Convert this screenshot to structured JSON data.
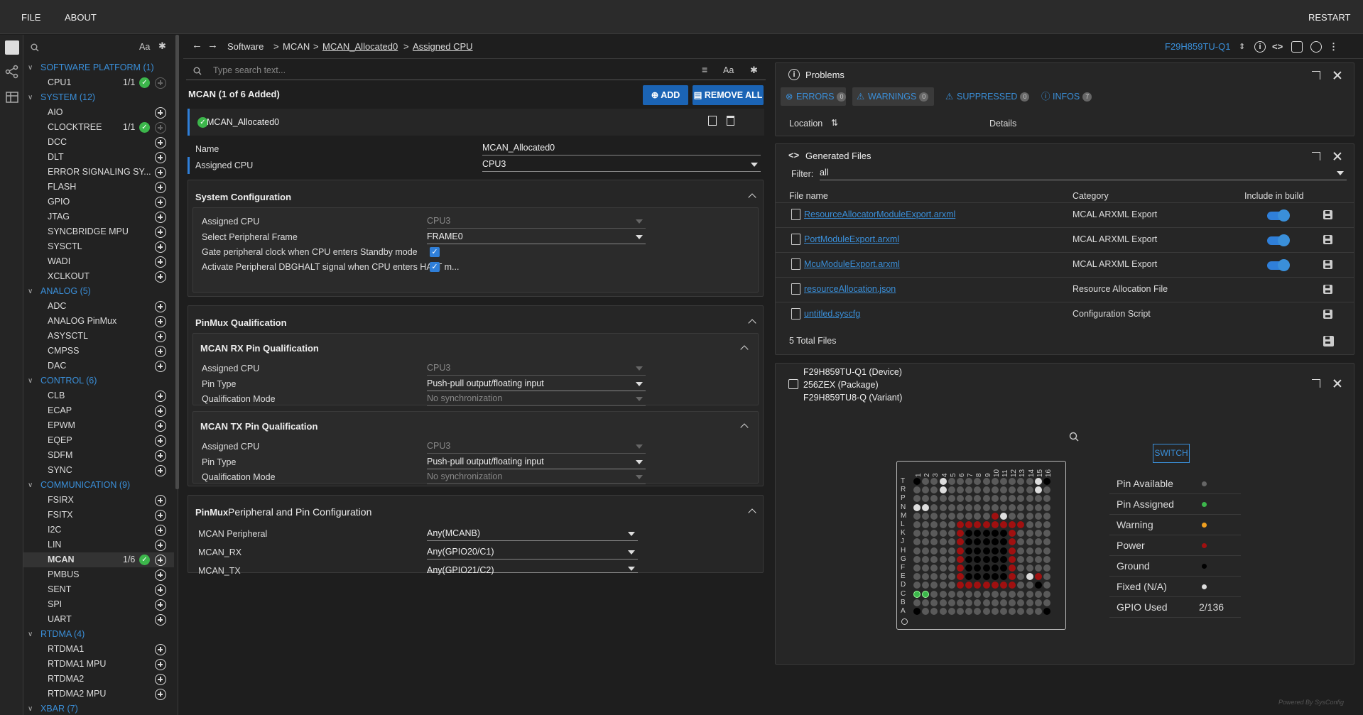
{
  "menu": {
    "file": "FILE",
    "about": "ABOUT",
    "restart": "RESTART"
  },
  "sidebar": {
    "search_placeholder": "",
    "case_label": "Aa",
    "groups": [
      {
        "label": "SOFTWARE PLATFORM (1)",
        "items": [
          {
            "label": "CPU1",
            "count": "1/1",
            "checked": true,
            "add": "dim"
          }
        ]
      },
      {
        "label": "SYSTEM (12)",
        "items": [
          {
            "label": "AIO"
          },
          {
            "label": "CLOCKTREE",
            "count": "1/1",
            "checked": true,
            "add": "dim"
          },
          {
            "label": "DCC"
          },
          {
            "label": "DLT"
          },
          {
            "label": "ERROR SIGNALING SY..."
          },
          {
            "label": "FLASH"
          },
          {
            "label": "GPIO"
          },
          {
            "label": "JTAG"
          },
          {
            "label": "SYNCBRIDGE MPU"
          },
          {
            "label": "SYSCTL"
          },
          {
            "label": "WADI"
          },
          {
            "label": "XCLKOUT"
          }
        ]
      },
      {
        "label": "ANALOG (5)",
        "items": [
          {
            "label": "ADC"
          },
          {
            "label": "ANALOG PinMux"
          },
          {
            "label": "ASYSCTL"
          },
          {
            "label": "CMPSS"
          },
          {
            "label": "DAC"
          }
        ]
      },
      {
        "label": "CONTROL (6)",
        "items": [
          {
            "label": "CLB"
          },
          {
            "label": "ECAP"
          },
          {
            "label": "EPWM"
          },
          {
            "label": "EQEP"
          },
          {
            "label": "SDFM"
          },
          {
            "label": "SYNC"
          }
        ]
      },
      {
        "label": "COMMUNICATION (9)",
        "items": [
          {
            "label": "FSIRX"
          },
          {
            "label": "FSITX"
          },
          {
            "label": "I2C"
          },
          {
            "label": "LIN"
          },
          {
            "label": "MCAN",
            "count": "1/6",
            "checked": true,
            "selected": true
          },
          {
            "label": "PMBUS"
          },
          {
            "label": "SENT"
          },
          {
            "label": "SPI"
          },
          {
            "label": "UART"
          }
        ]
      },
      {
        "label": "RTDMA (4)",
        "items": [
          {
            "label": "RTDMA1"
          },
          {
            "label": "RTDMA1 MPU"
          },
          {
            "label": "RTDMA2"
          },
          {
            "label": "RTDMA2 MPU"
          }
        ]
      },
      {
        "label": "XBAR (7)",
        "items": []
      }
    ]
  },
  "breadcrumb": {
    "b1": "Software",
    "b2": "MCAN",
    "b3": "MCAN_Allocated0",
    "b4": "Assigned CPU",
    "sep": ">"
  },
  "device_select": "F29H859TU-Q1",
  "search": {
    "placeholder": "Type search text...",
    "case": "Aa"
  },
  "module": {
    "title": "MCAN (1 of 6 Added)",
    "add": "ADD",
    "remove_all": "REMOVE ALL",
    "instance": "MCAN_Allocated0"
  },
  "fields": {
    "name_label": "Name",
    "name_value": "MCAN_Allocated0",
    "cpu_label": "Assigned CPU",
    "cpu_value": "CPU3"
  },
  "syscfg": {
    "title": "System Configuration",
    "cpu_label": "Assigned CPU",
    "cpu_value": "CPU3",
    "frame_label": "Select Peripheral Frame",
    "frame_value": "FRAME0",
    "gate_label": "Gate peripheral clock when CPU enters Standby mode",
    "dbg_label": "Activate Peripheral DBGHALT signal when CPU enters HALT m..."
  },
  "pinmux_q": {
    "title": "PinMux Qualification",
    "rx": {
      "title": "MCAN RX Pin Qualification",
      "cpu_label": "Assigned CPU",
      "cpu_value": "CPU3",
      "type_label": "Pin Type",
      "type_value": "Push-pull output/floating input",
      "mode_label": "Qualification Mode",
      "mode_value": "No synchronization"
    },
    "tx": {
      "title": "MCAN TX Pin Qualification",
      "cpu_label": "Assigned CPU",
      "cpu_value": "CPU3",
      "type_label": "Pin Type",
      "type_value": "Push-pull output/floating input",
      "mode_label": "Qualification Mode",
      "mode_value": "No synchronization"
    }
  },
  "pinmux_cfg": {
    "title_bold": "PinMux",
    "title_rest": "Peripheral and Pin Configuration",
    "periph_label": "MCAN Peripheral",
    "periph_value": "Any(MCANB)",
    "rx_label": "MCAN_RX",
    "rx_value": "Any(GPIO20/C1)",
    "tx_label": "MCAN_TX",
    "tx_value": "Any(GPIO21/C2)"
  },
  "problems": {
    "title": "Problems",
    "errors": "ERRORS",
    "errors_n": "0",
    "warnings": "WARNINGS",
    "warnings_n": "0",
    "suppressed": "SUPPRESSED",
    "suppressed_n": "0",
    "infos": "INFOS",
    "infos_n": "7",
    "col_location": "Location",
    "col_details": "Details"
  },
  "generated": {
    "title": "Generated Files",
    "filter_label": "Filter:",
    "filter_value": "all",
    "col_file": "File name",
    "col_category": "Category",
    "col_include": "Include in build",
    "files": [
      {
        "name": "ResourceAllocatorModuleExport.arxml",
        "category": "MCAL ARXML Export",
        "toggle": true
      },
      {
        "name": "PortModuleExport.arxml",
        "category": "MCAL ARXML Export",
        "toggle": true
      },
      {
        "name": "McuModuleExport.arxml",
        "category": "MCAL ARXML Export",
        "toggle": true
      },
      {
        "name": "resourceAllocation.json",
        "category": "Resource Allocation File",
        "toggle": false
      },
      {
        "name": "untitled.syscfg",
        "category": "Configuration Script",
        "toggle": false
      }
    ],
    "total": "5 Total Files"
  },
  "device": {
    "line1": "F29H859TU-Q1 (Device)",
    "line2": "256ZEX (Package)",
    "line3": "F29H859TU8-Q (Variant)",
    "switch": "SWITCH",
    "col_labels": [
      "1",
      "2",
      "3",
      "4",
      "5",
      "6",
      "7",
      "8",
      "9",
      "10",
      "11",
      "12",
      "13",
      "14",
      "15",
      "16"
    ],
    "row_labels": [
      "T",
      "R",
      "P",
      "N",
      "M",
      "L",
      "K",
      "J",
      "H",
      "G",
      "F",
      "E",
      "D",
      "C",
      "B",
      "A"
    ]
  },
  "legend": [
    {
      "label": "Pin Available",
      "color": "#666666"
    },
    {
      "label": "Pin Assigned",
      "color": "#3cb64b"
    },
    {
      "label": "Warning",
      "color": "#f0a020"
    },
    {
      "label": "Power",
      "color": "#a01010"
    },
    {
      "label": "Ground",
      "color": "#000000"
    },
    {
      "label": "Fixed (N/A)",
      "color": "#dddddd"
    },
    {
      "label": "GPIO Used",
      "value": "2/136"
    }
  ],
  "footer": "Powered By SysConfig",
  "colors": {
    "accent": "#3a8fd9",
    "button": "#1b64b5",
    "check": "#3cb64b"
  }
}
